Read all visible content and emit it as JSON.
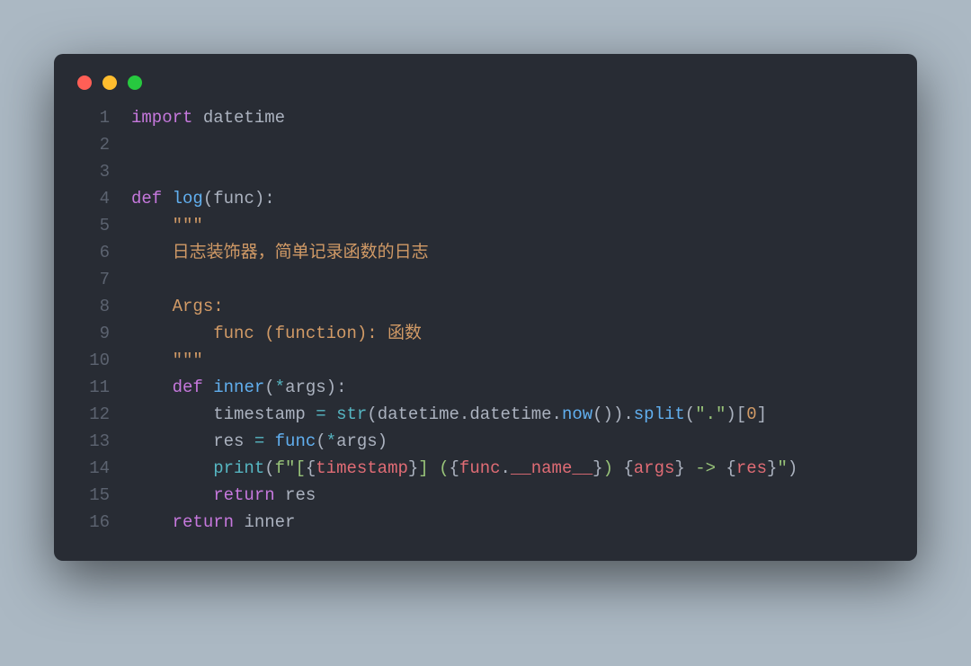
{
  "window": {
    "traffic_lights": [
      "close",
      "minimize",
      "zoom"
    ]
  },
  "code": {
    "lines": [
      {
        "n": "1",
        "tokens": [
          {
            "cls": "c-key",
            "t": "import"
          },
          {
            "cls": "c-punc",
            "t": " "
          },
          {
            "cls": "c-mod",
            "t": "datetime"
          }
        ]
      },
      {
        "n": "2",
        "tokens": []
      },
      {
        "n": "3",
        "tokens": []
      },
      {
        "n": "4",
        "tokens": [
          {
            "cls": "c-key",
            "t": "def"
          },
          {
            "cls": "c-punc",
            "t": " "
          },
          {
            "cls": "c-func",
            "t": "log"
          },
          {
            "cls": "c-punc",
            "t": "("
          },
          {
            "cls": "c-param",
            "t": "func"
          },
          {
            "cls": "c-punc",
            "t": "):"
          }
        ]
      },
      {
        "n": "5",
        "tokens": [
          {
            "cls": "c-punc",
            "t": "    "
          },
          {
            "cls": "c-doc",
            "t": "\"\"\""
          }
        ]
      },
      {
        "n": "6",
        "tokens": [
          {
            "cls": "c-punc",
            "t": "    "
          },
          {
            "cls": "c-doc",
            "t": "日志装饰器，简单记录函数的日志"
          }
        ]
      },
      {
        "n": "7",
        "tokens": []
      },
      {
        "n": "8",
        "tokens": [
          {
            "cls": "c-punc",
            "t": "    "
          },
          {
            "cls": "c-doc",
            "t": "Args:"
          }
        ]
      },
      {
        "n": "9",
        "tokens": [
          {
            "cls": "c-punc",
            "t": "        "
          },
          {
            "cls": "c-doc",
            "t": "func (function): 函数"
          }
        ]
      },
      {
        "n": "10",
        "tokens": [
          {
            "cls": "c-punc",
            "t": "    "
          },
          {
            "cls": "c-doc",
            "t": "\"\"\""
          }
        ]
      },
      {
        "n": "11",
        "tokens": [
          {
            "cls": "c-punc",
            "t": "    "
          },
          {
            "cls": "c-key",
            "t": "def"
          },
          {
            "cls": "c-punc",
            "t": " "
          },
          {
            "cls": "c-func",
            "t": "inner"
          },
          {
            "cls": "c-punc",
            "t": "("
          },
          {
            "cls": "c-op",
            "t": "*"
          },
          {
            "cls": "c-param",
            "t": "args"
          },
          {
            "cls": "c-punc",
            "t": "):"
          }
        ]
      },
      {
        "n": "12",
        "tokens": [
          {
            "cls": "c-punc",
            "t": "        "
          },
          {
            "cls": "c-mod",
            "t": "timestamp "
          },
          {
            "cls": "c-op",
            "t": "="
          },
          {
            "cls": "c-punc",
            "t": " "
          },
          {
            "cls": "c-builtin",
            "t": "str"
          },
          {
            "cls": "c-punc",
            "t": "("
          },
          {
            "cls": "c-mod",
            "t": "datetime"
          },
          {
            "cls": "c-punc",
            "t": "."
          },
          {
            "cls": "c-mod",
            "t": "datetime"
          },
          {
            "cls": "c-punc",
            "t": "."
          },
          {
            "cls": "c-attr",
            "t": "now"
          },
          {
            "cls": "c-punc",
            "t": "())."
          },
          {
            "cls": "c-attr",
            "t": "split"
          },
          {
            "cls": "c-punc",
            "t": "("
          },
          {
            "cls": "c-str",
            "t": "\".\""
          },
          {
            "cls": "c-punc",
            "t": ")["
          },
          {
            "cls": "c-num",
            "t": "0"
          },
          {
            "cls": "c-punc",
            "t": "]"
          }
        ]
      },
      {
        "n": "13",
        "tokens": [
          {
            "cls": "c-punc",
            "t": "        "
          },
          {
            "cls": "c-mod",
            "t": "res "
          },
          {
            "cls": "c-op",
            "t": "="
          },
          {
            "cls": "c-punc",
            "t": " "
          },
          {
            "cls": "c-attr",
            "t": "func"
          },
          {
            "cls": "c-punc",
            "t": "("
          },
          {
            "cls": "c-op",
            "t": "*"
          },
          {
            "cls": "c-mod",
            "t": "args"
          },
          {
            "cls": "c-punc",
            "t": ")"
          }
        ]
      },
      {
        "n": "14",
        "tokens": [
          {
            "cls": "c-punc",
            "t": "        "
          },
          {
            "cls": "c-builtin",
            "t": "print"
          },
          {
            "cls": "c-punc",
            "t": "("
          },
          {
            "cls": "c-str",
            "t": "f\"["
          },
          {
            "cls": "c-brace",
            "t": "{"
          },
          {
            "cls": "c-fstr",
            "t": "timestamp"
          },
          {
            "cls": "c-brace",
            "t": "}"
          },
          {
            "cls": "c-str",
            "t": "] ("
          },
          {
            "cls": "c-brace",
            "t": "{"
          },
          {
            "cls": "c-fstr",
            "t": "func"
          },
          {
            "cls": "c-punc",
            "t": "."
          },
          {
            "cls": "c-dunder",
            "t": "__name__"
          },
          {
            "cls": "c-brace",
            "t": "}"
          },
          {
            "cls": "c-str",
            "t": ") "
          },
          {
            "cls": "c-brace",
            "t": "{"
          },
          {
            "cls": "c-fstr",
            "t": "args"
          },
          {
            "cls": "c-brace",
            "t": "}"
          },
          {
            "cls": "c-str",
            "t": " -> "
          },
          {
            "cls": "c-brace",
            "t": "{"
          },
          {
            "cls": "c-fstr",
            "t": "res"
          },
          {
            "cls": "c-brace",
            "t": "}"
          },
          {
            "cls": "c-str",
            "t": "\""
          },
          {
            "cls": "c-punc",
            "t": ")"
          }
        ]
      },
      {
        "n": "15",
        "tokens": [
          {
            "cls": "c-punc",
            "t": "        "
          },
          {
            "cls": "c-key",
            "t": "return"
          },
          {
            "cls": "c-punc",
            "t": " "
          },
          {
            "cls": "c-mod",
            "t": "res"
          }
        ]
      },
      {
        "n": "16",
        "tokens": [
          {
            "cls": "c-punc",
            "t": "    "
          },
          {
            "cls": "c-key",
            "t": "return"
          },
          {
            "cls": "c-punc",
            "t": " "
          },
          {
            "cls": "c-mod",
            "t": "inner"
          }
        ]
      }
    ]
  }
}
